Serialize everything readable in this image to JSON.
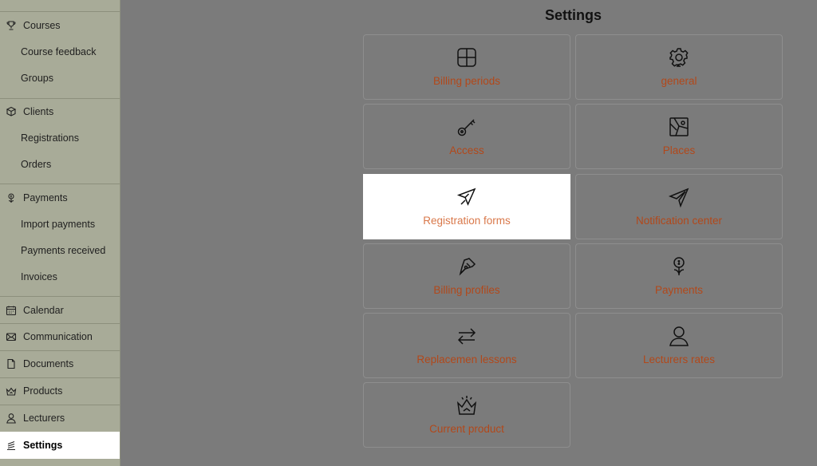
{
  "sidebar": {
    "items": [
      {
        "label": "Courses",
        "icon": "trophy-icon"
      },
      {
        "label": "Course feedback"
      },
      {
        "label": "Groups"
      },
      {
        "label": "Clients",
        "icon": "box-icon"
      },
      {
        "label": "Registrations"
      },
      {
        "label": "Orders"
      },
      {
        "label": "Payments",
        "icon": "money-icon"
      },
      {
        "label": "Import payments"
      },
      {
        "label": "Payments received"
      },
      {
        "label": "Invoices"
      },
      {
        "label": "Calendar",
        "icon": "calendar-icon"
      },
      {
        "label": "Communication",
        "icon": "envelope-icon"
      },
      {
        "label": "Documents",
        "icon": "document-icon"
      },
      {
        "label": "Products",
        "icon": "crown-icon"
      },
      {
        "label": "Lecturers",
        "icon": "user-icon"
      },
      {
        "label": "Settings",
        "icon": "settings-icon",
        "active": true
      }
    ]
  },
  "main": {
    "title": "Settings",
    "cards": [
      {
        "label": "Billing periods",
        "icon": "grid-icon"
      },
      {
        "label": "general",
        "icon": "gear-icon"
      },
      {
        "label": "Access",
        "icon": "key-icon"
      },
      {
        "label": "Places",
        "icon": "map-icon"
      },
      {
        "label": "Registration forms",
        "icon": "cursor-arrow-icon",
        "highlighted": true
      },
      {
        "label": "Notification center",
        "icon": "paper-plane-icon"
      },
      {
        "label": "Billing profiles",
        "icon": "pen-nib-icon"
      },
      {
        "label": "Payments",
        "icon": "money-plant-icon"
      },
      {
        "label": "Replacemen lessons",
        "icon": "swap-arrows-icon"
      },
      {
        "label": "Lecturers rates",
        "icon": "person-icon"
      },
      {
        "label": "Current product",
        "icon": "crown-icon"
      }
    ]
  },
  "colors": {
    "sidebar_bg": "#a8ab98",
    "overlay_bg": "#7b7b7b",
    "label_orange": "#b2481a",
    "label_orange_highlight": "#d9784a"
  }
}
